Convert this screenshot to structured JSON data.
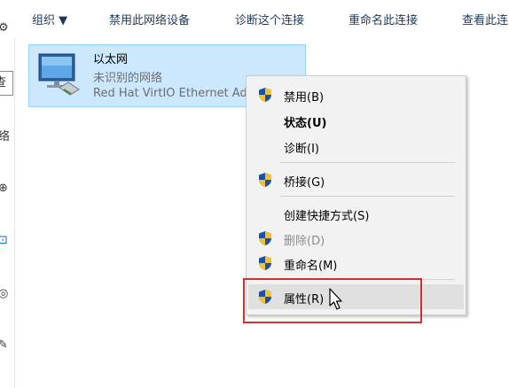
{
  "toolbar": {
    "organize_label": "组织 ▼",
    "disable_label": "禁用此网络设备",
    "diagnose_label": "诊断这个连接",
    "rename_label": "重命名此连接",
    "view_label": "查看此连"
  },
  "left_strip": {
    "search_fragment": "查",
    "nav_fragment": "络"
  },
  "adapter": {
    "name": "以太网",
    "status": "未识别的网络",
    "device": "Red Hat VirtIO Ethernet Adapter"
  },
  "context_menu": {
    "items": [
      {
        "label": "禁用(B)",
        "icon": "uac-shield-icon"
      },
      {
        "label": "状态(U)",
        "bold": true
      },
      {
        "label": "诊断(I)"
      },
      {
        "label": "桥接(G)",
        "icon": "uac-shield-icon"
      },
      {
        "label": "创建快捷方式(S)"
      },
      {
        "label": "删除(D)",
        "icon": "uac-shield-icon",
        "disabled": true
      },
      {
        "label": "重命名(M)",
        "icon": "uac-shield-icon"
      },
      {
        "label": "属性(R)",
        "icon": "uac-shield-icon",
        "hovered": true
      }
    ]
  },
  "colors": {
    "selection_bg": "#cce8ff",
    "selection_border": "#99d1ff",
    "menu_bg": "#f2f2f2",
    "highlight_box": "#d03030",
    "toolbar_text": "#1e395b"
  }
}
